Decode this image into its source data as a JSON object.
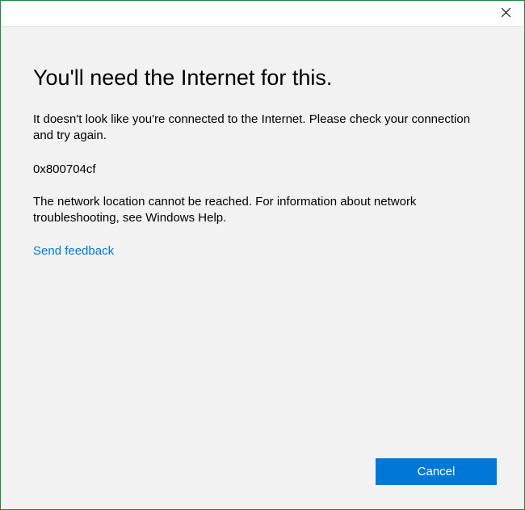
{
  "dialog": {
    "heading": "You'll need the Internet for this.",
    "message": "It doesn't look like you're connected to the Internet. Please check your connection and try again.",
    "error_code": "0x800704cf",
    "details": "The network location cannot be reached. For information about network troubleshooting, see Windows Help.",
    "feedback_link": "Send feedback",
    "cancel_button": "Cancel"
  }
}
